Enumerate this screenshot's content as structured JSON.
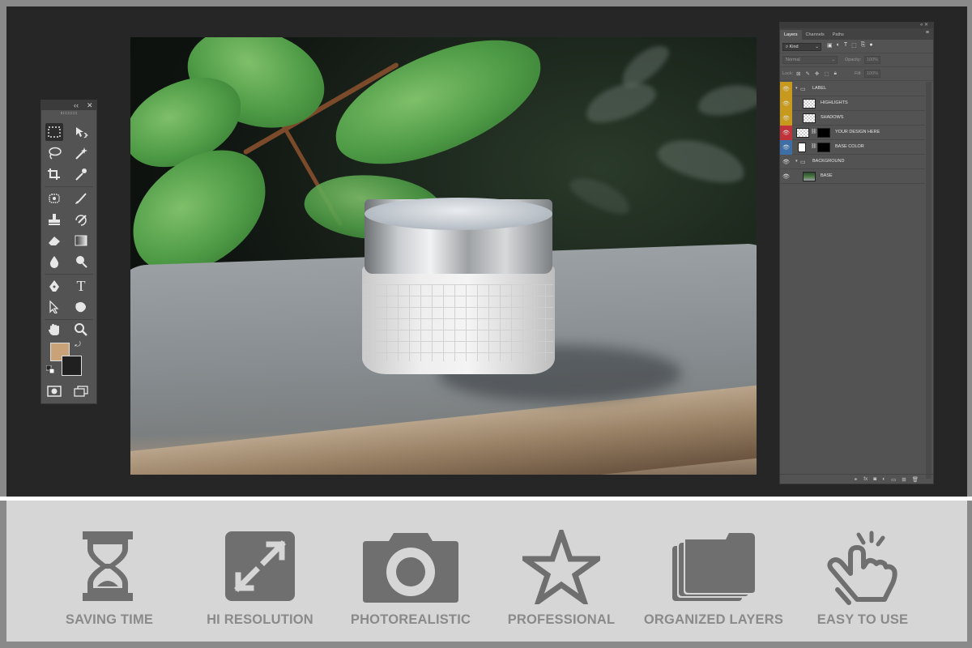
{
  "layers_panel": {
    "tabs": [
      "Layers",
      "Channels",
      "Paths"
    ],
    "filter_kind": "Kind",
    "blend_mode": "Normal",
    "opacity_label": "Opacity:",
    "opacity_value": "100%",
    "lock_label": "Lock:",
    "fill_label": "Fill:",
    "fill_value": "100%",
    "layers": [
      {
        "name": "LABEL",
        "type": "group",
        "vis_color": "#c79a1e"
      },
      {
        "name": "HIGHLIGHTS",
        "type": "layer",
        "vis_color": "#c79a1e"
      },
      {
        "name": "SHADOWS",
        "type": "layer",
        "vis_color": "#c79a1e"
      },
      {
        "name": "YOUR DESIGN HERE",
        "type": "smart-object",
        "vis_color": "#c0333a"
      },
      {
        "name": "BASE COLOR",
        "type": "fill",
        "vis_color": "#3d6fa6"
      },
      {
        "name": "BACKGROUND",
        "type": "group",
        "vis_color": null
      },
      {
        "name": "BASE",
        "type": "layer",
        "vis_color": null
      }
    ]
  },
  "tools_panel": {
    "tools": [
      "marquee-tool",
      "move-tool",
      "lasso-tool",
      "magic-wand-tool",
      "crop-tool",
      "eyedropper-tool",
      "spot-heal-tool",
      "brush-tool",
      "stamp-tool",
      "history-brush-tool",
      "eraser-tool",
      "gradient-tool",
      "blur-tool",
      "dodge-tool",
      "pen-tool",
      "type-tool",
      "path-select-tool",
      "shape-tool",
      "hand-tool",
      "zoom-tool",
      "quick-mask",
      "screen-mode"
    ],
    "type_tool_glyph": "T",
    "foreground_color": "#c9a277",
    "background_color": "#202020"
  },
  "features": [
    {
      "label": "SAVING TIME",
      "icon": "hourglass-icon"
    },
    {
      "label": "HI RESOLUTION",
      "icon": "expand-icon"
    },
    {
      "label": "PHOTOREALISTIC",
      "icon": "camera-icon"
    },
    {
      "label": "PROFESSIONAL",
      "icon": "star-icon"
    },
    {
      "label": "ORGANIZED LAYERS",
      "icon": "layers-icon"
    },
    {
      "label": "EASY TO USE",
      "icon": "hand-click-icon"
    }
  ],
  "colors": {
    "feature_icon": "#6f6f6f",
    "feature_label": "#8a8a8a",
    "panel_bg": "#535353"
  }
}
